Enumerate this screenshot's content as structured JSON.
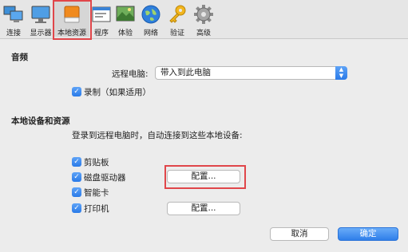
{
  "toolbar": {
    "items": [
      {
        "label": "连接",
        "icon": "connection-icon"
      },
      {
        "label": "显示器",
        "icon": "display-icon"
      },
      {
        "label": "本地资源",
        "icon": "local-resources-icon",
        "selected": true
      },
      {
        "label": "程序",
        "icon": "programs-icon"
      },
      {
        "label": "体验",
        "icon": "experience-icon"
      },
      {
        "label": "网络",
        "icon": "network-globe-icon"
      },
      {
        "label": "验证",
        "icon": "key-icon"
      },
      {
        "label": "高级",
        "icon": "gear-icon"
      }
    ]
  },
  "audio": {
    "title": "音频",
    "remote_computer_label": "远程电脑:",
    "remote_computer_value": "带入到此电脑",
    "record_label": "录制（如果适用）",
    "record_checked": true
  },
  "local_devices": {
    "title": "本地设备和资源",
    "description": "登录到远程电脑时，自动连接到这些本地设备:",
    "items": [
      {
        "label": "剪贴板",
        "checked": true
      },
      {
        "label": "磁盘驱动器",
        "checked": true,
        "button": "配置..."
      },
      {
        "label": "智能卡",
        "checked": true
      },
      {
        "label": "打印机",
        "checked": true,
        "button": "配置..."
      }
    ]
  },
  "footer": {
    "cancel_label": "取消",
    "ok_label": "确定"
  },
  "colors": {
    "accent": "#2a7ae8",
    "highlight_box": "#e0464a"
  }
}
